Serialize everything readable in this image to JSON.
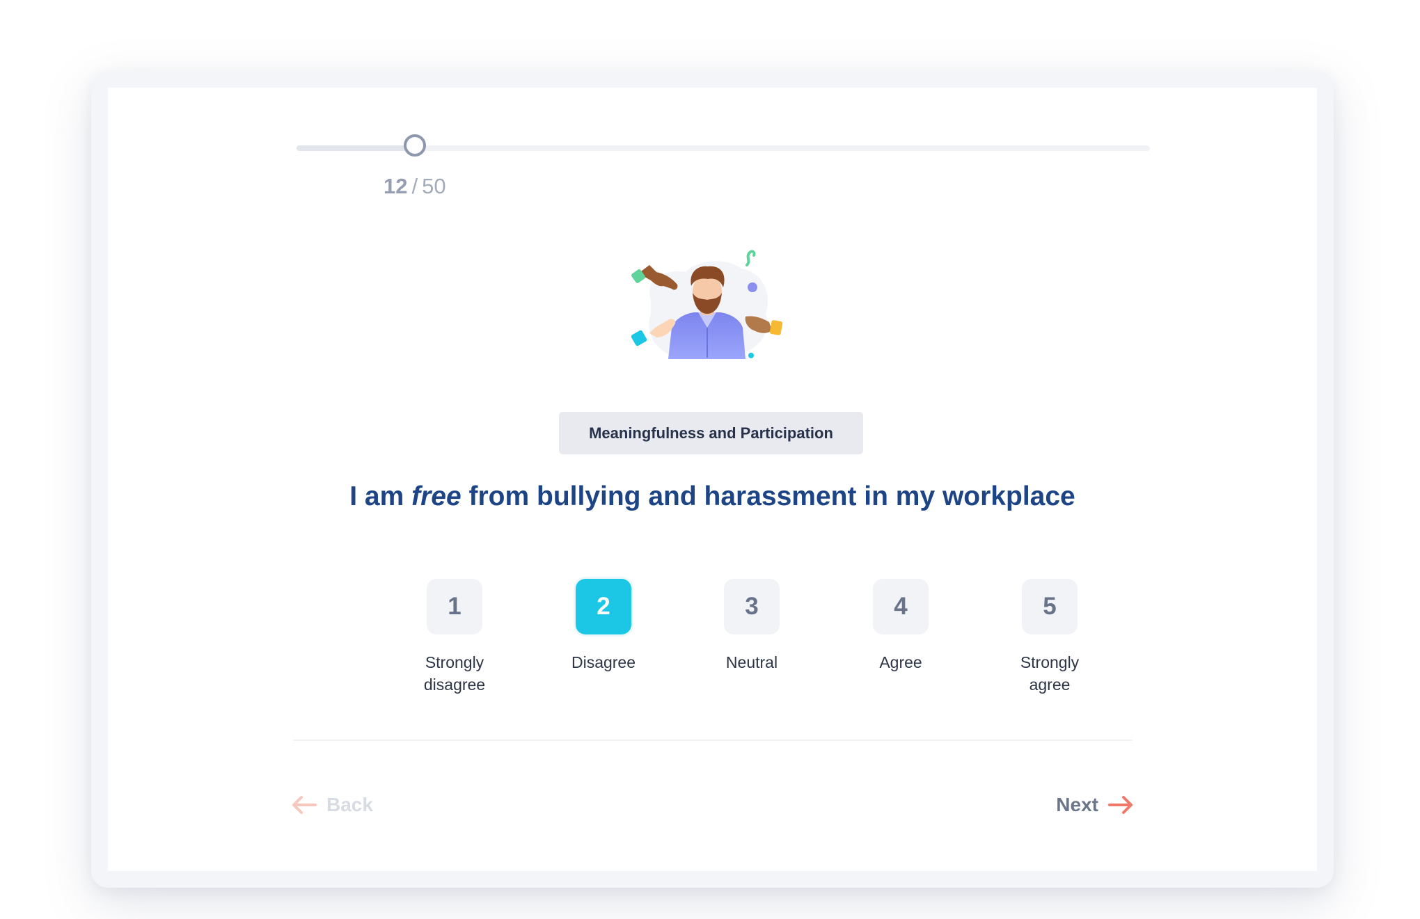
{
  "progress": {
    "current": "12",
    "separator": "/",
    "total": "50",
    "fraction": 0.14
  },
  "illustration": {
    "icon": "person-with-hands-illustration"
  },
  "category": {
    "label": "Meaningfulness and Participation"
  },
  "question": {
    "prefix": "I am ",
    "emphasis": "free",
    "suffix": " from bullying and harassment in my workplace"
  },
  "options": [
    {
      "value": "1",
      "label": "Strongly disagree",
      "selected": false
    },
    {
      "value": "2",
      "label": "Disagree",
      "selected": true
    },
    {
      "value": "3",
      "label": "Neutral",
      "selected": false
    },
    {
      "value": "4",
      "label": "Agree",
      "selected": false
    },
    {
      "value": "5",
      "label": "Strongly agree",
      "selected": false
    }
  ],
  "navigation": {
    "back_label": "Back",
    "next_label": "Next"
  },
  "colors": {
    "accent": "#1cc7e6",
    "question_text": "#1d4485",
    "arrow": "#ef7a6a",
    "arrow_disabled": "#f6c7bd"
  }
}
